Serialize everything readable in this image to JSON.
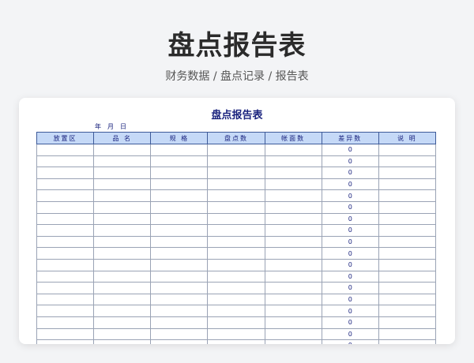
{
  "hero": {
    "title": "盘点报告表",
    "subtitle": "财务数据 / 盘点记录 / 报告表"
  },
  "sheet": {
    "title": "盘点报告表",
    "date_labels": [
      "年",
      "月",
      "日"
    ],
    "columns": [
      "放置区",
      "品 名",
      "规 格",
      "盘点数",
      "帐面数",
      "差异数",
      "说 明"
    ],
    "rows": [
      [
        "",
        "",
        "",
        "",
        "",
        "0",
        ""
      ],
      [
        "",
        "",
        "",
        "",
        "",
        "0",
        ""
      ],
      [
        "",
        "",
        "",
        "",
        "",
        "0",
        ""
      ],
      [
        "",
        "",
        "",
        "",
        "",
        "0",
        ""
      ],
      [
        "",
        "",
        "",
        "",
        "",
        "0",
        ""
      ],
      [
        "",
        "",
        "",
        "",
        "",
        "0",
        ""
      ],
      [
        "",
        "",
        "",
        "",
        "",
        "0",
        ""
      ],
      [
        "",
        "",
        "",
        "",
        "",
        "0",
        ""
      ],
      [
        "",
        "",
        "",
        "",
        "",
        "0",
        ""
      ],
      [
        "",
        "",
        "",
        "",
        "",
        "0",
        ""
      ],
      [
        "",
        "",
        "",
        "",
        "",
        "0",
        ""
      ],
      [
        "",
        "",
        "",
        "",
        "",
        "0",
        ""
      ],
      [
        "",
        "",
        "",
        "",
        "",
        "0",
        ""
      ],
      [
        "",
        "",
        "",
        "",
        "",
        "0",
        ""
      ],
      [
        "",
        "",
        "",
        "",
        "",
        "0",
        ""
      ],
      [
        "",
        "",
        "",
        "",
        "",
        "0",
        ""
      ],
      [
        "",
        "",
        "",
        "",
        "",
        "0",
        ""
      ],
      [
        "",
        "",
        "",
        "",
        "",
        "0",
        ""
      ]
    ]
  }
}
